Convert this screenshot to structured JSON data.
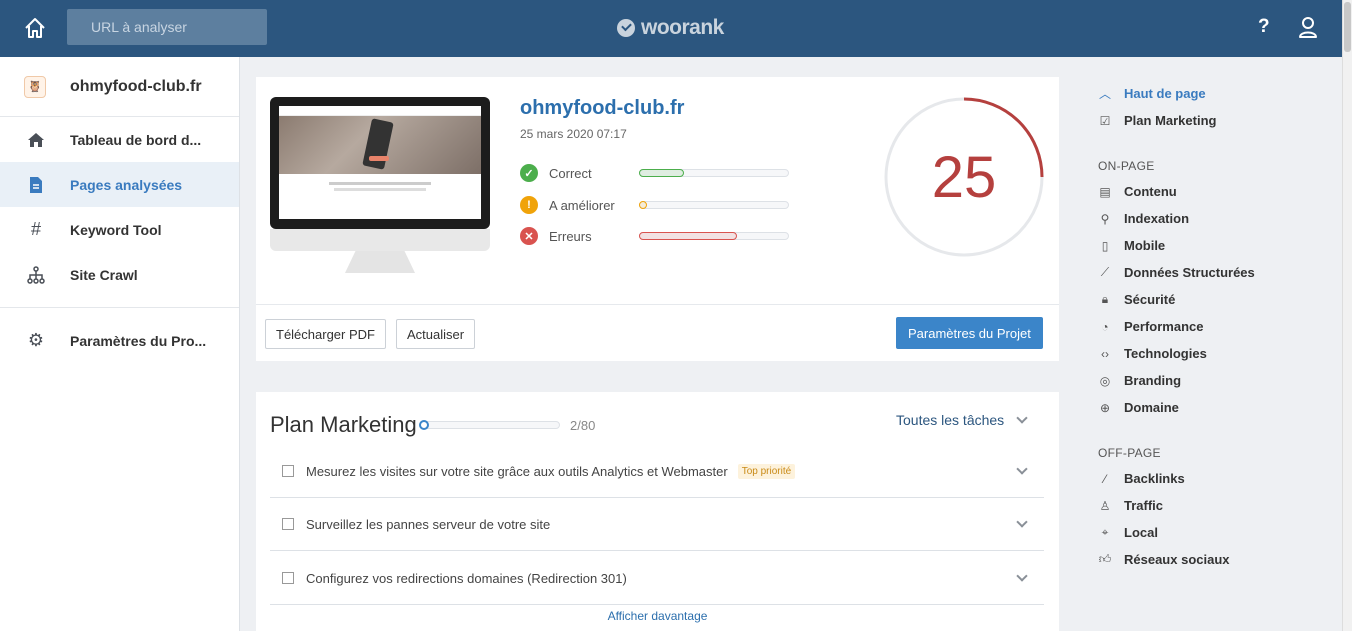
{
  "header": {
    "url_placeholder": "URL à analyser",
    "logo_text": "woorank",
    "help_label": "?"
  },
  "sidebar": {
    "site_name": "ohmyfood-club.fr",
    "items": [
      {
        "label": "Tableau de bord d...",
        "icon": "home-icon"
      },
      {
        "label": "Pages analysées",
        "icon": "document-icon",
        "active": true
      },
      {
        "label": "Keyword Tool",
        "icon": "hash-icon"
      },
      {
        "label": "Site Crawl",
        "icon": "sitemap-icon"
      },
      {
        "label": "Paramètres du Pro...",
        "icon": "gear-icon"
      }
    ]
  },
  "summary": {
    "site_title": "ohmyfood-club.fr",
    "date": "25 mars 2020 07:17",
    "score": "25",
    "score_fraction": 0.25,
    "metrics": [
      {
        "label": "Correct",
        "fraction": 0.3,
        "color": "#4cae4c",
        "icon": "check-icon",
        "symbol": "✓"
      },
      {
        "label": "A améliorer",
        "fraction": 0.02,
        "color": "#f0a30a",
        "icon": "warning-icon",
        "symbol": "!"
      },
      {
        "label": "Erreurs",
        "fraction": 0.65,
        "color": "#d9534f",
        "icon": "error-icon",
        "symbol": "✕"
      }
    ],
    "download_pdf": "Télécharger PDF",
    "refresh": "Actualiser",
    "project_settings": "Paramètres du Projet"
  },
  "marketing": {
    "title": "Plan Marketing",
    "progress_count": "2/80",
    "filter_label": "Toutes les tâches",
    "tasks": [
      {
        "text": "Mesurez les visites sur votre site grâce aux outils Analytics et Webmaster",
        "badge": "Top priorité"
      },
      {
        "text": "Surveillez les pannes serveur de votre site",
        "badge": ""
      },
      {
        "text": "Configurez vos redirections domaines (Redirection 301)",
        "badge": ""
      }
    ],
    "more_label": "Afficher davantage"
  },
  "toc": {
    "top_label": "Haut de page",
    "plan_label": "Plan Marketing",
    "on_page_heading": "ON-PAGE",
    "on_page": [
      "Contenu",
      "Indexation",
      "Mobile",
      "Données Structurées",
      "Sécurité",
      "Performance",
      "Technologies",
      "Branding",
      "Domaine"
    ],
    "off_page_heading": "OFF-PAGE",
    "off_page": [
      "Backlinks",
      "Traffic",
      "Local",
      "Réseaux sociaux"
    ]
  },
  "colors": {
    "topbar": "#2c567f",
    "accent": "#3b85c9",
    "score": "#b5403e"
  }
}
